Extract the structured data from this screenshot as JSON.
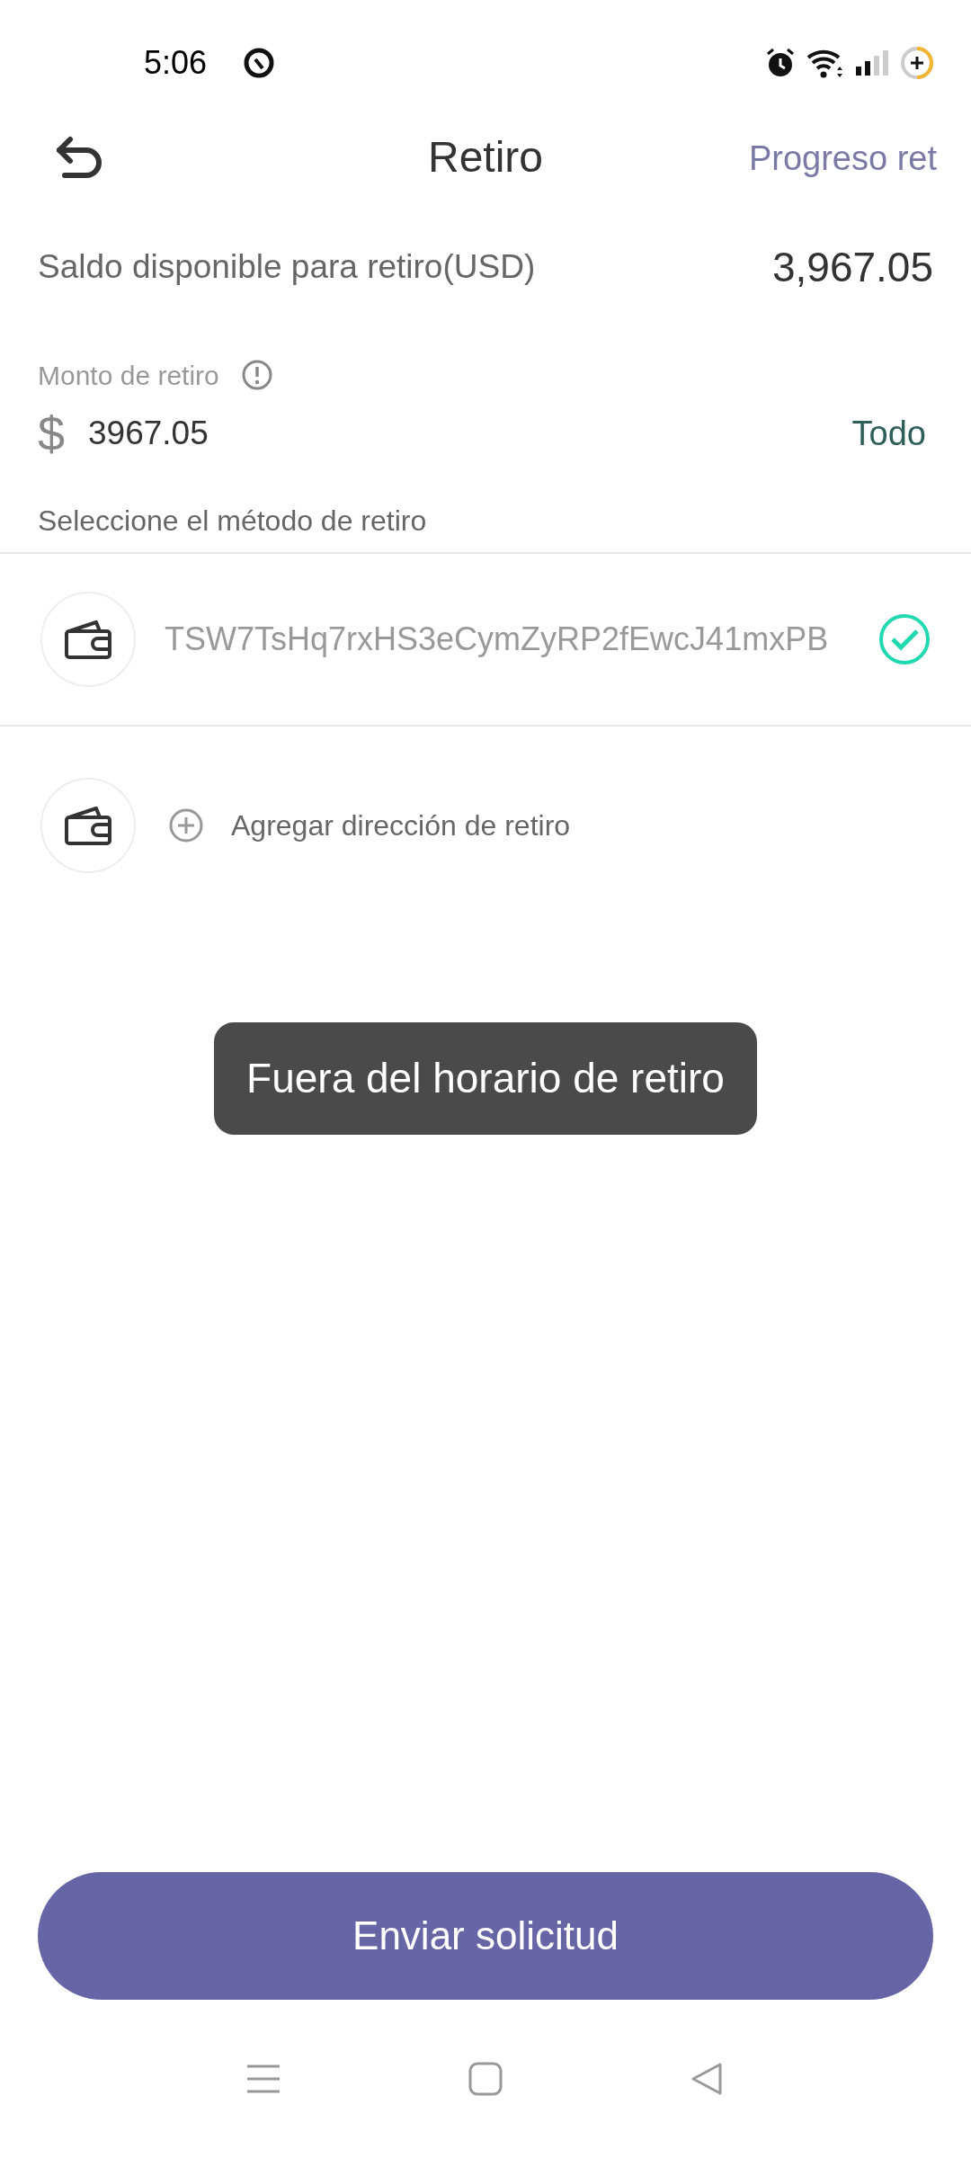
{
  "status_bar": {
    "time": "5:06"
  },
  "header": {
    "title": "Retiro",
    "action": "Progreso ret"
  },
  "balance": {
    "label": "Saldo disponible para retiro(USD)",
    "value": "3,967.05"
  },
  "amount": {
    "label": "Monto de retiro",
    "currency": "$",
    "value": "3967.05",
    "all_link": "Todo"
  },
  "method_section": {
    "label": "Seleccione el método de retiro"
  },
  "addresses": [
    {
      "address": "TSW7TsHq7rxHS3eCymZyRP2fEwcJ41mxPB",
      "selected": true
    }
  ],
  "add_address": {
    "label": "Agregar dirección de retiro"
  },
  "toast": {
    "text": "Fuera del horario de retiro"
  },
  "submit_button": {
    "label": "Enviar solicitud"
  }
}
